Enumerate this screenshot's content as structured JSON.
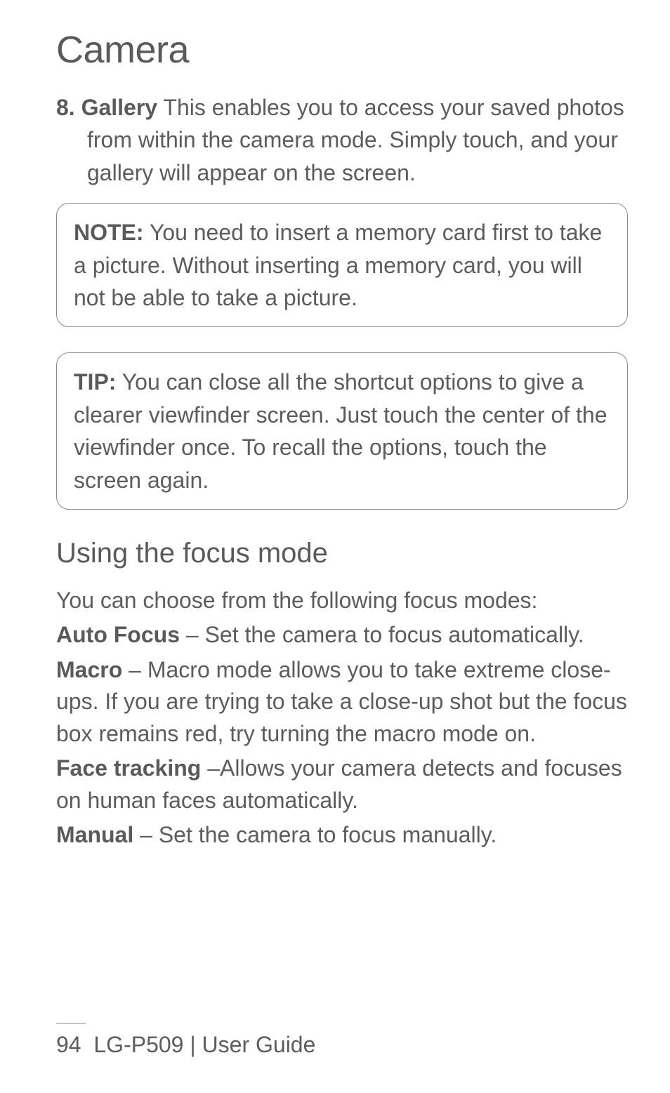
{
  "title": "Camera",
  "list": {
    "number": "8.",
    "label": "Gallery",
    "text": " This enables you to access your saved photos from within the camera mode. Simply touch, and your gallery will appear on the screen."
  },
  "note": {
    "label": "NOTE:",
    "text": " You need to insert a memory card first to take a picture. Without inserting a memory card, you will not be able to take a picture."
  },
  "tip": {
    "label": "TIP:",
    "text": " You can close all the shortcut options to give a clearer viewfinder screen. Just touch the center of the viewfinder once. To recall the options, touch the screen again."
  },
  "section": {
    "heading": "Using the focus mode",
    "intro": "You can choose from the following focus modes:",
    "items": [
      {
        "label": "Auto Focus",
        "text": " – Set the camera to focus automatically."
      },
      {
        "label": "Macro",
        "text": " – Macro mode allows you to take extreme close-ups. If you are trying to take a close-up shot but the focus box remains red, try turning the macro mode on."
      },
      {
        "label": "Face tracking",
        "text": " –Allows your camera detects and focuses on human faces automatically."
      },
      {
        "label": "Manual",
        "text": " – Set the camera to focus manually."
      }
    ]
  },
  "footer": {
    "page": "94",
    "doc": "LG-P509  |  User Guide"
  }
}
